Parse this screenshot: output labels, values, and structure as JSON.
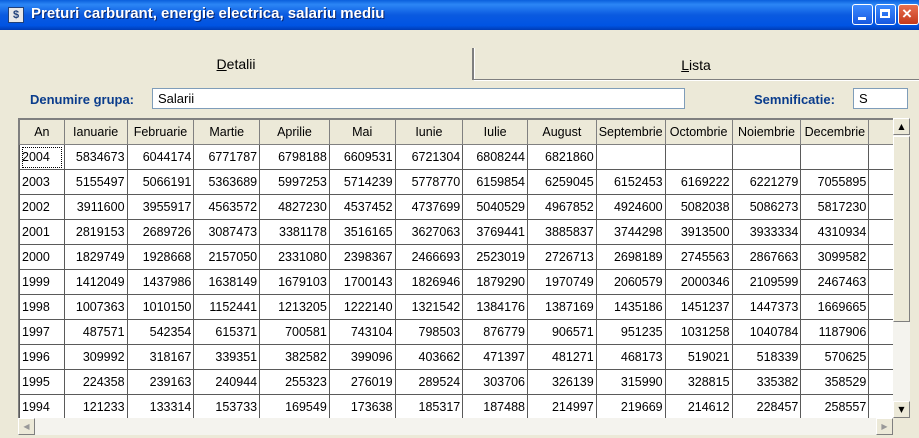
{
  "window": {
    "title": "Preturi carburant, energie electrica, salariu mediu",
    "icon": "app-icon",
    "icon_glyph": "$",
    "close_glyph": "×"
  },
  "tabs": [
    {
      "label_ul": "D",
      "label_rest": "etalii",
      "active": true
    },
    {
      "label_ul": "L",
      "label_rest": "ista",
      "active": false
    }
  ],
  "form": {
    "grupa_label": "Denumire grupa:",
    "grupa_value": "Salarii",
    "semnificatie_label": "Semnificatie:",
    "semnificatie_value": "S"
  },
  "table": {
    "columns": [
      "An",
      "Ianuarie",
      "Februarie",
      "Martie",
      "Aprilie",
      "Mai",
      "Iunie",
      "Iulie",
      "August",
      "Septembrie",
      "Octombrie",
      "Noiembrie",
      "Decembrie"
    ],
    "rows": [
      [
        "2004",
        "5834673",
        "6044174",
        "6771787",
        "6798188",
        "6609531",
        "6721304",
        "6808244",
        "6821860",
        "",
        "",
        "",
        ""
      ],
      [
        "2003",
        "5155497",
        "5066191",
        "5363689",
        "5997253",
        "5714239",
        "5778770",
        "6159854",
        "6259045",
        "6152453",
        "6169222",
        "6221279",
        "7055895"
      ],
      [
        "2002",
        "3911600",
        "3955917",
        "4563572",
        "4827230",
        "4537452",
        "4737699",
        "5040529",
        "4967852",
        "4924600",
        "5082038",
        "5086273",
        "5817230"
      ],
      [
        "2001",
        "2819153",
        "2689726",
        "3087473",
        "3381178",
        "3516165",
        "3627063",
        "3769441",
        "3885837",
        "3744298",
        "3913500",
        "3933334",
        "4310934"
      ],
      [
        "2000",
        "1829749",
        "1928668",
        "2157050",
        "2331080",
        "2398367",
        "2466693",
        "2523019",
        "2726713",
        "2698189",
        "2745563",
        "2867663",
        "3099582"
      ],
      [
        "1999",
        "1412049",
        "1437986",
        "1638149",
        "1679103",
        "1700143",
        "1826946",
        "1879290",
        "1970749",
        "2060579",
        "2000346",
        "2109599",
        "2467463"
      ],
      [
        "1998",
        "1007363",
        "1010150",
        "1152441",
        "1213205",
        "1222140",
        "1321542",
        "1384176",
        "1387169",
        "1435186",
        "1451237",
        "1447373",
        "1669665"
      ],
      [
        "1997",
        "487571",
        "542354",
        "615371",
        "700581",
        "743104",
        "798503",
        "876779",
        "906571",
        "951235",
        "1031258",
        "1040784",
        "1187906"
      ],
      [
        "1996",
        "309992",
        "318167",
        "339351",
        "382582",
        "399096",
        "403662",
        "471397",
        "481271",
        "468173",
        "519021",
        "518339",
        "570625"
      ],
      [
        "1995",
        "224358",
        "239163",
        "240944",
        "255323",
        "276019",
        "289524",
        "303706",
        "326139",
        "315990",
        "328815",
        "335382",
        "358529"
      ],
      [
        "1994",
        "121233",
        "133314",
        "153733",
        "169549",
        "173638",
        "185317",
        "187488",
        "214997",
        "219669",
        "214612",
        "228457",
        "258557"
      ]
    ],
    "selected_row_year": "2004"
  },
  "scrollbars": {
    "up_glyph": "▲",
    "down_glyph": "▼",
    "left_glyph": "◀",
    "right_glyph": "▶"
  }
}
